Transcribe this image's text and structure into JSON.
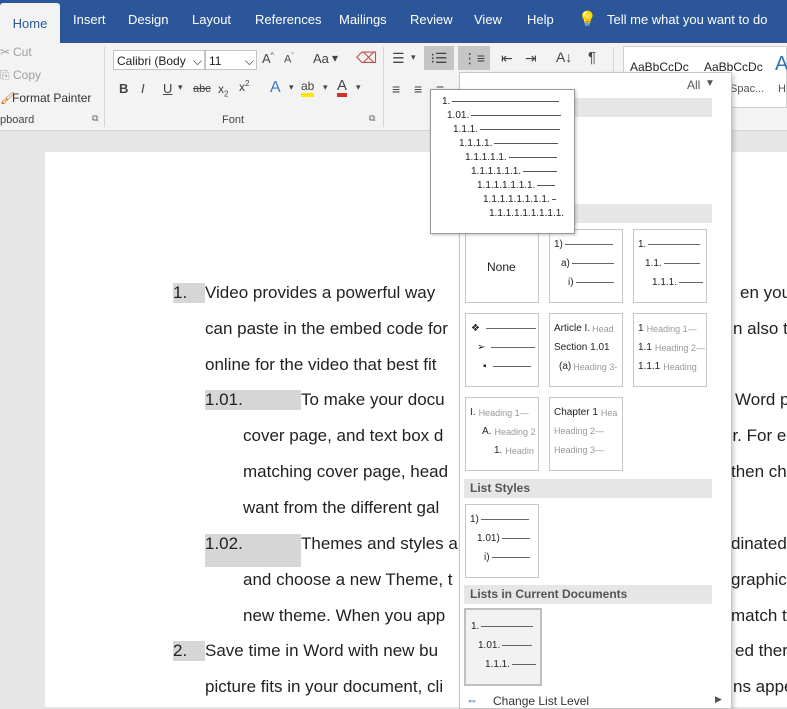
{
  "tabs": [
    "Home",
    "Insert",
    "Design",
    "Layout",
    "References",
    "Mailings",
    "Review",
    "View",
    "Help"
  ],
  "tell_me": "Tell me what you want to do",
  "clipboard": {
    "cut": "Cut",
    "copy": "Copy",
    "format_painter": "Format Painter",
    "group": "pboard"
  },
  "font": {
    "name": "Calibri (Body",
    "size": "11",
    "group": "Font",
    "case": "Aa"
  },
  "styles": {
    "style1": "AaBbCcDc",
    "style2": "AaBbCcDc",
    "style3": "A",
    "label2": "Spac...",
    "label3": "H"
  },
  "gallery": {
    "filter": "All",
    "none_label": "None",
    "list_styles_header": "List Styles",
    "current_docs_header": "Lists in Current Documents",
    "footer": "Change List Level"
  },
  "preview": [
    "1.",
    "1.01.",
    "1.1.1.",
    "1.1.1.1.",
    "1.1.1.1.1.",
    "1.1.1.1.1.1.",
    "1.1.1.1.1.1.1.",
    "1.1.1.1.1.1.1.1.",
    "1.1.1.1.1.1.1.1.1."
  ],
  "cells": {
    "c1": [
      "1)",
      "a)",
      "i)"
    ],
    "c2": [
      "1.",
      "1.1.",
      "1.1.1."
    ],
    "c4": [
      "Article I.",
      "Section 1.01",
      "(a)"
    ],
    "c4h": [
      "Head",
      "",
      "Heading 3-"
    ],
    "c5": [
      "1",
      "1.1",
      "1.1.1"
    ],
    "c5h": [
      "Heading 1—",
      "Heading 2—",
      "Heading"
    ],
    "c6": [
      "I.",
      "A.",
      "1."
    ],
    "c6h": [
      "Heading 1—",
      "Heading 2",
      "Headin"
    ],
    "c7": [
      "Chapter 1",
      "",
      ""
    ],
    "c7h": [
      "Hea",
      "Heading 2—",
      "Heading 3—"
    ],
    "ls": [
      "1)",
      "1.01)",
      "i)"
    ],
    "cur": [
      "1.",
      "1.01.",
      "1.1.1."
    ]
  },
  "doc": {
    "l1_num": "1.",
    "l1a": "Video provides a powerful way",
    "l1a_r": "en you",
    "l1b": "can paste in the embed code for",
    "l1b_r": "n also ty",
    "l1c": "online for the video that best fit",
    "l2_num": "1.01.",
    "l2a": "To make your docu",
    "l2a_r": "Word p",
    "l2b": "cover page, and text box d",
    "l2b_r": "er. For e",
    "l2c": "matching cover page, head",
    "l2c_r": "then ch",
    "l2d": "want from the different gal",
    "l3_num": "1.02.",
    "l3a": "Themes and styles a",
    "l3a_r": "dinated",
    "l3b": "and choose a new Theme, t",
    "l3b_r": "graphic",
    "l3c": "new theme. When you app",
    "l3c_r": "match t",
    "l4_num": "2.",
    "l4a": "Save time in Word with new bu",
    "l4a_r": "ed ther",
    "l4b": "picture fits in your document, cli",
    "l4b_r": "ns appe"
  }
}
